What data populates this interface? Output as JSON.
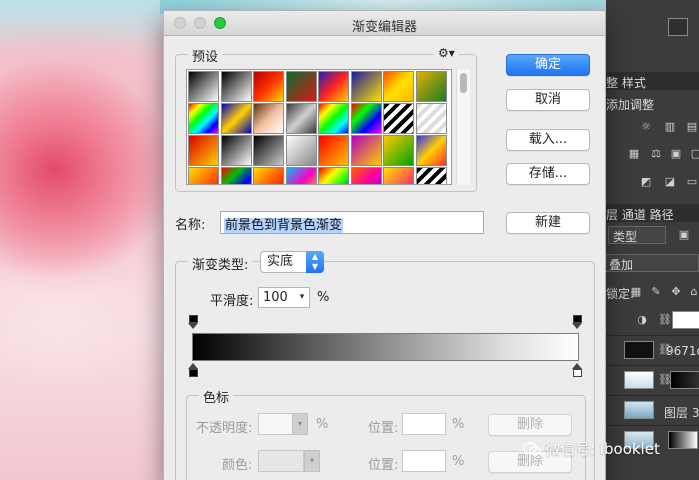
{
  "dialog": {
    "title": "渐变编辑器",
    "presets_label": "预设",
    "gear_glyph": "⚙▾",
    "buttons": {
      "ok": "确定",
      "cancel": "取消",
      "load": "载入...",
      "save": "存储...",
      "new": "新建"
    },
    "name_label": "名称:",
    "name_value": "前景色到背景色渐变",
    "type_label": "渐变类型:",
    "type_value": "实底",
    "smooth_label": "平滑度:",
    "smooth_value": "100",
    "percent": "%",
    "stops_group": "色标",
    "opacity_label": "不透明度:",
    "color_label": "颜色:",
    "position_label": "位置:",
    "delete_label": "删除"
  },
  "presets": [
    {
      "bg": "linear-gradient(135deg,#000,#fff)"
    },
    {
      "bg": "linear-gradient(135deg,#000,#fff)"
    },
    {
      "bg": "linear-gradient(135deg,#b40000,#ff3000,#ffd800)"
    },
    {
      "bg": "linear-gradient(135deg,#0b6b2a,#d81a1a)"
    },
    {
      "bg": "linear-gradient(135deg,#2020c0,#ff2020,#ffd000)"
    },
    {
      "bg": "linear-gradient(135deg,#1a1aa0,#ffe000)"
    },
    {
      "bg": "linear-gradient(135deg,#ff5000,#ffe100,#ffb300)"
    },
    {
      "bg": "linear-gradient(135deg,#e0b000,#1c7a2a)"
    },
    {
      "bg": "linear-gradient(135deg,#f00,#ff0,#0f0,#0ff,#00f,#f0f)"
    },
    {
      "bg": "linear-gradient(135deg,#0000c0,#ffd000,#0000c0)"
    },
    {
      "bg": "linear-gradient(135deg,#5a3010,#f4c0a0,#ffffff)"
    },
    {
      "bg": "linear-gradient(135deg,#3a3a3a,#cfcfcf,#3a3a3a)"
    },
    {
      "bg": "linear-gradient(135deg,#ff0000,#ffff00,#00ff00,#00ffff,#0000ff)"
    },
    {
      "bg": "linear-gradient(135deg,#ff0000,#00ff00,#0000ff,#ff00ff)"
    },
    {
      "bg": "repeating-linear-gradient(135deg,#000 0 4px,#fff 4px 8px)"
    },
    {
      "bg": "repeating-linear-gradient(135deg,#ddd 0 4px,#fff 4px 8px)"
    },
    {
      "bg": "linear-gradient(135deg,#d90000,#ffd000)"
    },
    {
      "bg": "linear-gradient(135deg,#000,#fff)"
    },
    {
      "bg": "linear-gradient(135deg,#000,#ccc)"
    },
    {
      "bg": "linear-gradient(135deg,#fff,#888)"
    },
    {
      "bg": "linear-gradient(135deg,#ff0000,#ffc000)"
    },
    {
      "bg": "linear-gradient(135deg,#b000c0,#ffd000)"
    },
    {
      "bg": "linear-gradient(135deg,#ffcc00,#00a000)"
    },
    {
      "bg": "linear-gradient(135deg,#3030ff,#ffd000,#ff3030)"
    },
    {
      "bg": "linear-gradient(135deg,#ffe000,#ff0000)"
    },
    {
      "bg": "linear-gradient(135deg,#ff0000,#00c000,#0000ff,#ff00ff)"
    },
    {
      "bg": "linear-gradient(135deg,#ffe000,#ff6000,#ff0000)"
    },
    {
      "bg": "linear-gradient(135deg,#00c0ff,#ff00c0,#ffd000)"
    },
    {
      "bg": "linear-gradient(135deg,#ff0000,#ffff00,#00ff00,#0000ff)"
    },
    {
      "bg": "linear-gradient(135deg,#ff6000,#ff00a0,#8000ff)"
    },
    {
      "bg": "linear-gradient(135deg,#ffe000,#ff0080)"
    },
    {
      "bg": "repeating-linear-gradient(135deg,#000 0 4px,#fff 4px 8px)"
    }
  ],
  "photoshop_panel": {
    "tabs_top": "整  样式",
    "add_adjust": "添加调整",
    "layers_tabs": "层  通道  路径",
    "kind": "类型",
    "blend": "叠加",
    "lock": "锁定:",
    "layer_name_1": "9671d",
    "layer_name_2": "图层 3"
  },
  "watermark": "微信号: ibooklet"
}
